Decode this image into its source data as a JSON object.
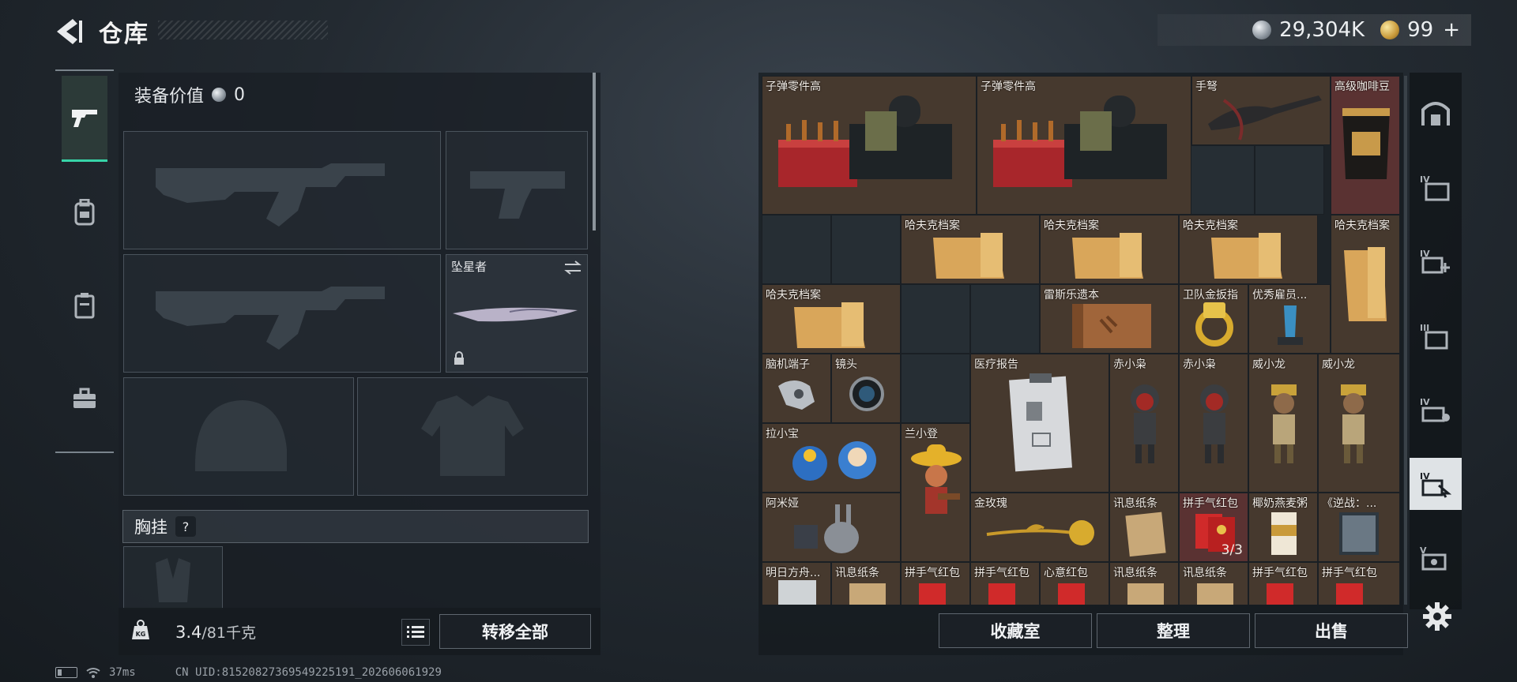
{
  "header": {
    "title": "仓库"
  },
  "currency": {
    "silver_amount": "29,304K",
    "gold_amount": "99",
    "gold_plus": "+"
  },
  "left_nav": {
    "items": [
      "weapon-icon",
      "backpack-icon",
      "vest-icon",
      "toolbox-icon"
    ],
    "active": "weapon-icon"
  },
  "loadout": {
    "equip_value_label": "装备价值",
    "equip_value": "0",
    "melee_slot_name": "坠星者",
    "chest_label": "胸挂",
    "chest_help": "?",
    "weight_current": "3.4",
    "weight_max": "/81千克",
    "transfer_all_label": "转移全部"
  },
  "inventory": {
    "items": [
      {
        "name": "子弹零件高",
        "icon": "ammo-parts-icon"
      },
      {
        "name": "子弹零件高",
        "icon": "ammo-parts-icon"
      },
      {
        "name": "手弩",
        "icon": "crossbow-icon"
      },
      {
        "name": "高级咖啡豆",
        "icon": "coffee-bag-icon"
      },
      {
        "name": "哈夫克档案",
        "icon": "folder-icon"
      },
      {
        "name": "哈夫克档案",
        "icon": "folder-icon"
      },
      {
        "name": "哈夫克档案",
        "icon": "folder-icon"
      },
      {
        "name": "哈夫克档案",
        "icon": "folder-icon"
      },
      {
        "name": "哈夫克档案",
        "icon": "folder-icon"
      },
      {
        "name": "雷斯乐遗本",
        "icon": "book-icon"
      },
      {
        "name": "卫队金扳指",
        "icon": "gold-ring-icon"
      },
      {
        "name": "优秀雇员...",
        "icon": "trophy-icon"
      },
      {
        "name": "脑机端子",
        "icon": "brain-terminal-icon"
      },
      {
        "name": "镜头",
        "icon": "lens-icon"
      },
      {
        "name": "医疗报告",
        "icon": "medical-report-icon"
      },
      {
        "name": "赤小枭",
        "icon": "figure-red-hood-icon"
      },
      {
        "name": "赤小枭",
        "icon": "figure-red-hood-icon"
      },
      {
        "name": "威小龙",
        "icon": "figure-gold-icon"
      },
      {
        "name": "威小龙",
        "icon": "figure-gold-icon"
      },
      {
        "name": "拉小宝",
        "icon": "plush-toy-icon"
      },
      {
        "name": "兰小登",
        "icon": "sombrero-figure-icon"
      },
      {
        "name": "阿米娅",
        "icon": "rabbit-figure-icon"
      },
      {
        "name": "金玫瑰",
        "icon": "gold-rose-icon"
      },
      {
        "name": "讯息纸条",
        "icon": "note-icon"
      },
      {
        "name": "拼手气红包",
        "icon": "red-envelope-icon",
        "count": "3/3"
      },
      {
        "name": "椰奶燕麦粥",
        "icon": "drink-box-icon"
      },
      {
        "name": "《逆战：...",
        "icon": "game-card-icon"
      },
      {
        "name": "明日方舟...",
        "icon": "card-icon"
      },
      {
        "name": "讯息纸条",
        "icon": "note-icon"
      },
      {
        "name": "拼手气红包",
        "icon": "red-envelope-icon"
      },
      {
        "name": "拼手气红包",
        "icon": "red-envelope-icon"
      },
      {
        "name": "心意红包",
        "icon": "red-envelope-icon"
      },
      {
        "name": "讯息纸条",
        "icon": "note-icon"
      },
      {
        "name": "讯息纸条",
        "icon": "note-icon"
      },
      {
        "name": "拼手气红包",
        "icon": "red-envelope-icon"
      },
      {
        "name": "拼手气红包",
        "icon": "red-envelope-icon"
      }
    ]
  },
  "inventory_buttons": {
    "collection": "收藏室",
    "sort": "整理",
    "sell": "出售"
  },
  "right_tabs": [
    "vault-icon",
    "storage-IV-icon",
    "storage-IV-plus-icon",
    "storage-III-icon",
    "storage-IV-b-icon",
    "storage-IV-c-icon",
    "storage-V-icon"
  ],
  "status": {
    "ping": "37ms",
    "uid": "CN UID:8152082736954922519​1_202606061929"
  }
}
